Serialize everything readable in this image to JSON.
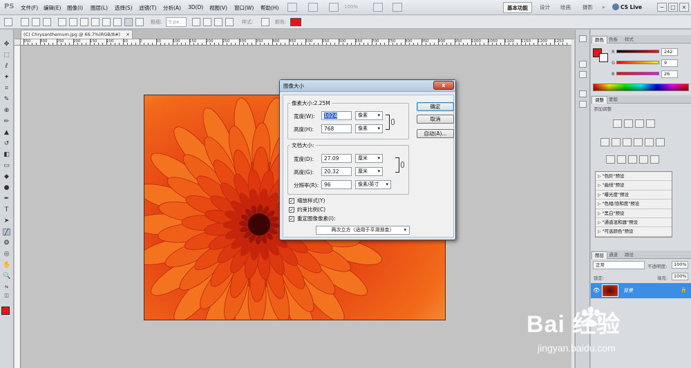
{
  "app": {
    "logo": "PS",
    "menus": [
      "文件(F)",
      "编辑(E)",
      "图像(I)",
      "图层(L)",
      "选择(S)",
      "滤镜(T)",
      "分析(A)",
      "3D(D)",
      "视图(V)",
      "窗口(W)",
      "帮助(H)"
    ],
    "zoom": "100%",
    "workspaces": [
      "基本功能",
      "设计",
      "绘画",
      "摄影"
    ],
    "more": "»",
    "cs_live": "CS Live",
    "window_controls": [
      "−",
      "□",
      "×"
    ]
  },
  "options": {
    "feather_label": "粗细:",
    "feather_value": "5 px",
    "style_label": "样式:",
    "color_label": "颜色:",
    "color": "#e8141c"
  },
  "document": {
    "tab_title": "(C) Chrysanthemum.jpg @ 66.7%(RGB/8#)",
    "tab_close": "×",
    "ruler_labels": [
      "350",
      "300",
      "250",
      "200",
      "150",
      "100",
      "50",
      "0",
      "50",
      "100",
      "150",
      "200",
      "250",
      "300",
      "350",
      "400",
      "450",
      "500",
      "550",
      "600",
      "650",
      "700",
      "750",
      "800",
      "850",
      "900",
      "950",
      "1000",
      "1050",
      "1100",
      "1150",
      "1200",
      "1250"
    ]
  },
  "dialog": {
    "title": "图像大小",
    "close": "x",
    "pixel_group": "像素大小:2.25M",
    "width_label": "宽度(W):",
    "width_value": "1024",
    "width_unit": "像素",
    "height_label": "高度(H):",
    "height_value": "768",
    "height_unit": "像素",
    "doc_group": "文档大小:",
    "doc_width_label": "宽度(D):",
    "doc_width_value": "27.09",
    "doc_width_unit": "厘米",
    "doc_height_label": "高度(G):",
    "doc_height_value": "20.32",
    "doc_height_unit": "厘米",
    "res_label": "分辨率(R):",
    "res_value": "96",
    "res_unit": "像素/英寸",
    "ok": "确定",
    "cancel": "取消",
    "auto": "自动(A)...",
    "scale_styles": "缩放样式(Y)",
    "constrain": "约束比例(C)",
    "resample": "重定图像像素(I):",
    "check_mark": "✓",
    "resample_method": "两次立方（适用于平滑渐变）"
  },
  "color_panel": {
    "tabs": [
      "颜色",
      "色板",
      "样式"
    ],
    "r_label": "R",
    "r_value": "242",
    "g_label": "G",
    "g_value": "9",
    "b_label": "B",
    "b_value": "26",
    "fg_color": "#e8141c"
  },
  "adjust_panel": {
    "tabs": [
      "调整",
      "蒙版"
    ],
    "heading": "添加调整",
    "presets": [
      "\"色阶\"预设",
      "\"曲线\"预设",
      "\"曝光度\"预设",
      "\"色相/饱和度\"预设",
      "\"黑白\"预设",
      "\"通道混和器\"预设",
      "\"可选颜色\"预设"
    ]
  },
  "layers_panel": {
    "tabs": [
      "图层",
      "通道",
      "路径"
    ],
    "blend_mode": "正常",
    "opacity_label": "不透明度:",
    "opacity_value": "100%",
    "lock_label": "锁定:",
    "fill_label": "填充:",
    "fill_value": "100%",
    "layer_name": "背景"
  },
  "watermark": {
    "brand": "Bai  经验",
    "url": "jingyan.baidu.com"
  }
}
